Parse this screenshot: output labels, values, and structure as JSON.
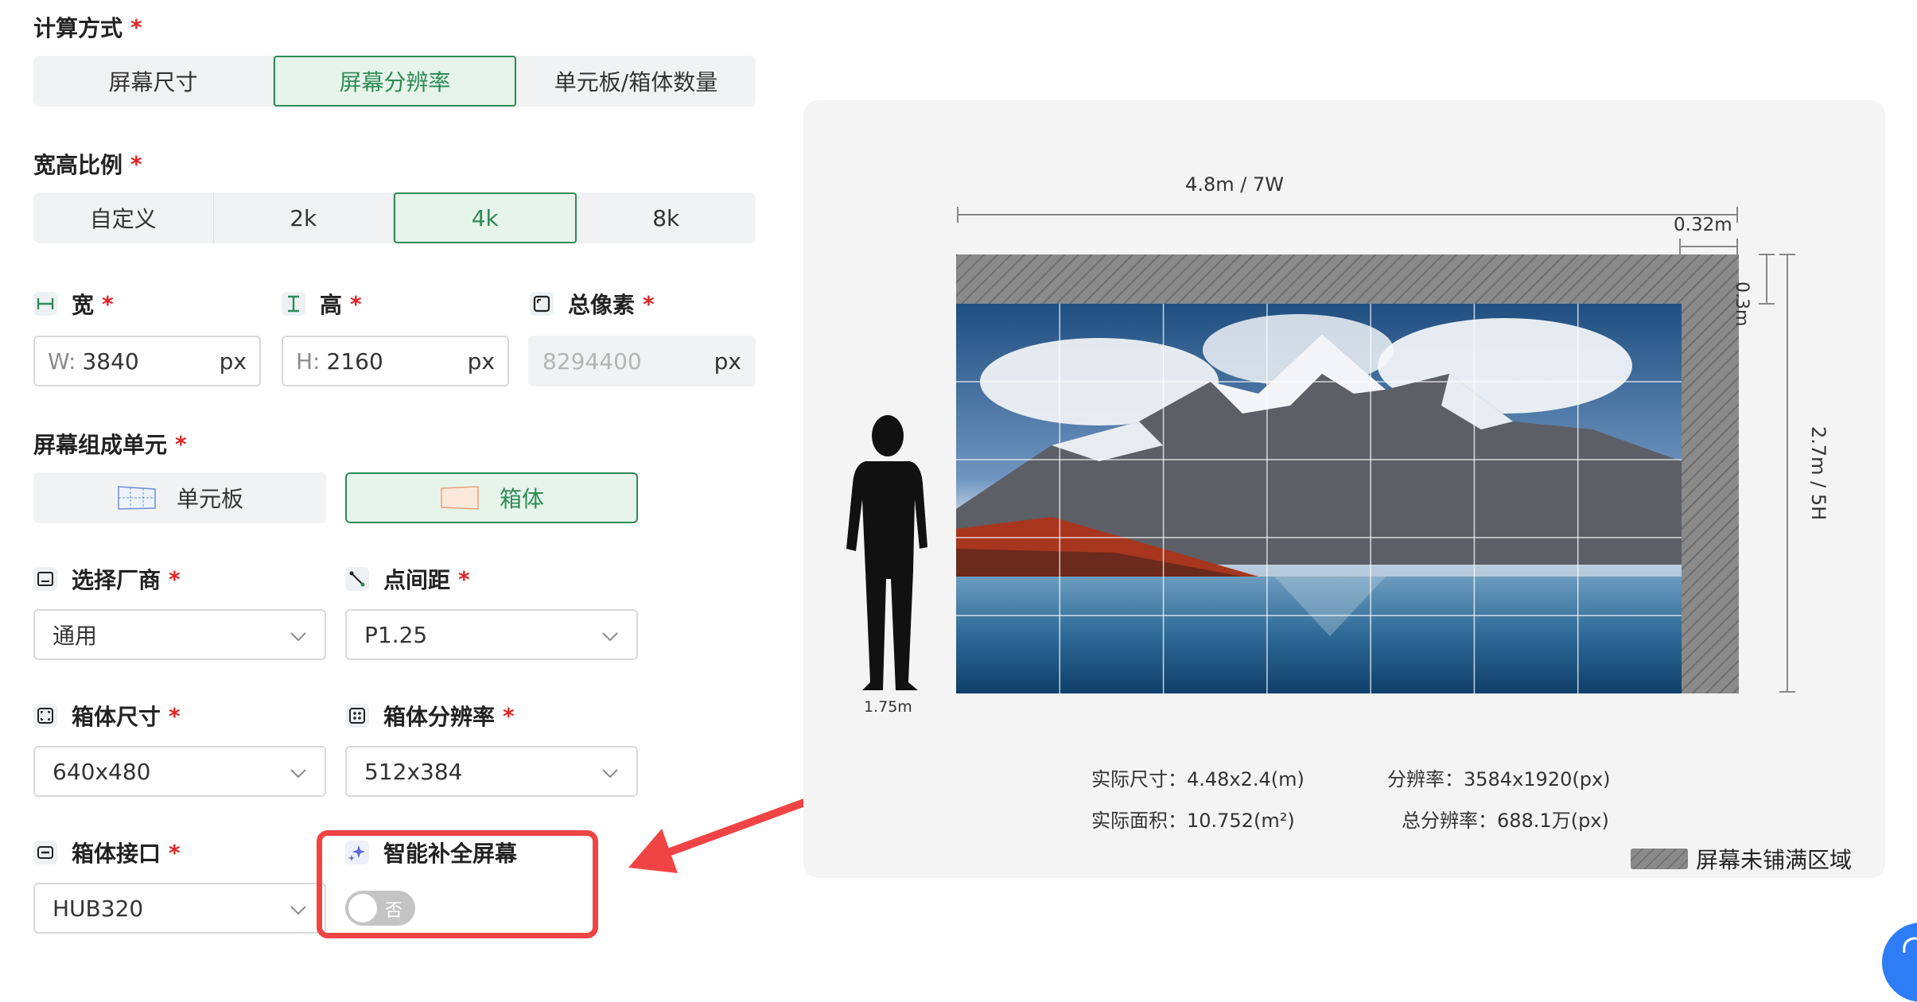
{
  "calc": {
    "label": "计算方式",
    "options": [
      "屏幕尺寸",
      "屏幕分辨率",
      "单元板/箱体数量"
    ],
    "selected": "屏幕分辨率"
  },
  "ratio": {
    "label": "宽高比例",
    "options": [
      "自定义",
      "2k",
      "4k",
      "8k"
    ],
    "selected": "4k"
  },
  "width": {
    "label": "宽",
    "prefix": "W:",
    "value": "3840",
    "unit": "px"
  },
  "height": {
    "label": "高",
    "prefix": "H:",
    "value": "2160",
    "unit": "px"
  },
  "pixels": {
    "label": "总像素",
    "value": "8294400",
    "unit": "px"
  },
  "unit": {
    "label": "屏幕组成单元",
    "options": [
      "单元板",
      "箱体"
    ],
    "selected": "箱体"
  },
  "vendor": {
    "label": "选择厂商",
    "value": "通用"
  },
  "pitch": {
    "label": "点间距",
    "value": "P1.25"
  },
  "cabinet_size": {
    "label": "箱体尺寸",
    "value": "640x480"
  },
  "cabinet_res": {
    "label": "箱体分辨率",
    "value": "512x384"
  },
  "interface": {
    "label": "箱体接口",
    "value": "HUB320"
  },
  "smart_fill": {
    "label": "智能补全屏幕",
    "toggle_text": "否",
    "enabled": false
  },
  "preview": {
    "top_dim": "4.8m / 7W",
    "right_gap_width": "0.32m",
    "top_gap_height": "0.3m",
    "side_dim": "2.7m / 5H",
    "person_height": "1.75m",
    "columns": 7,
    "rows": 5,
    "stats": {
      "actual_size": "实际尺寸：4.48x2.4(m)",
      "resolution": "分辨率：3584x1920(px)",
      "actual_area": "实际面积：10.752(m²)",
      "total_res": "总分辨率：688.1万(px)"
    },
    "legend": "屏幕未铺满区域"
  },
  "colors": {
    "accent": "#2e8b57",
    "accent_bg": "#e6f4ea",
    "required": "#e02424",
    "annotation": "#f04444"
  }
}
